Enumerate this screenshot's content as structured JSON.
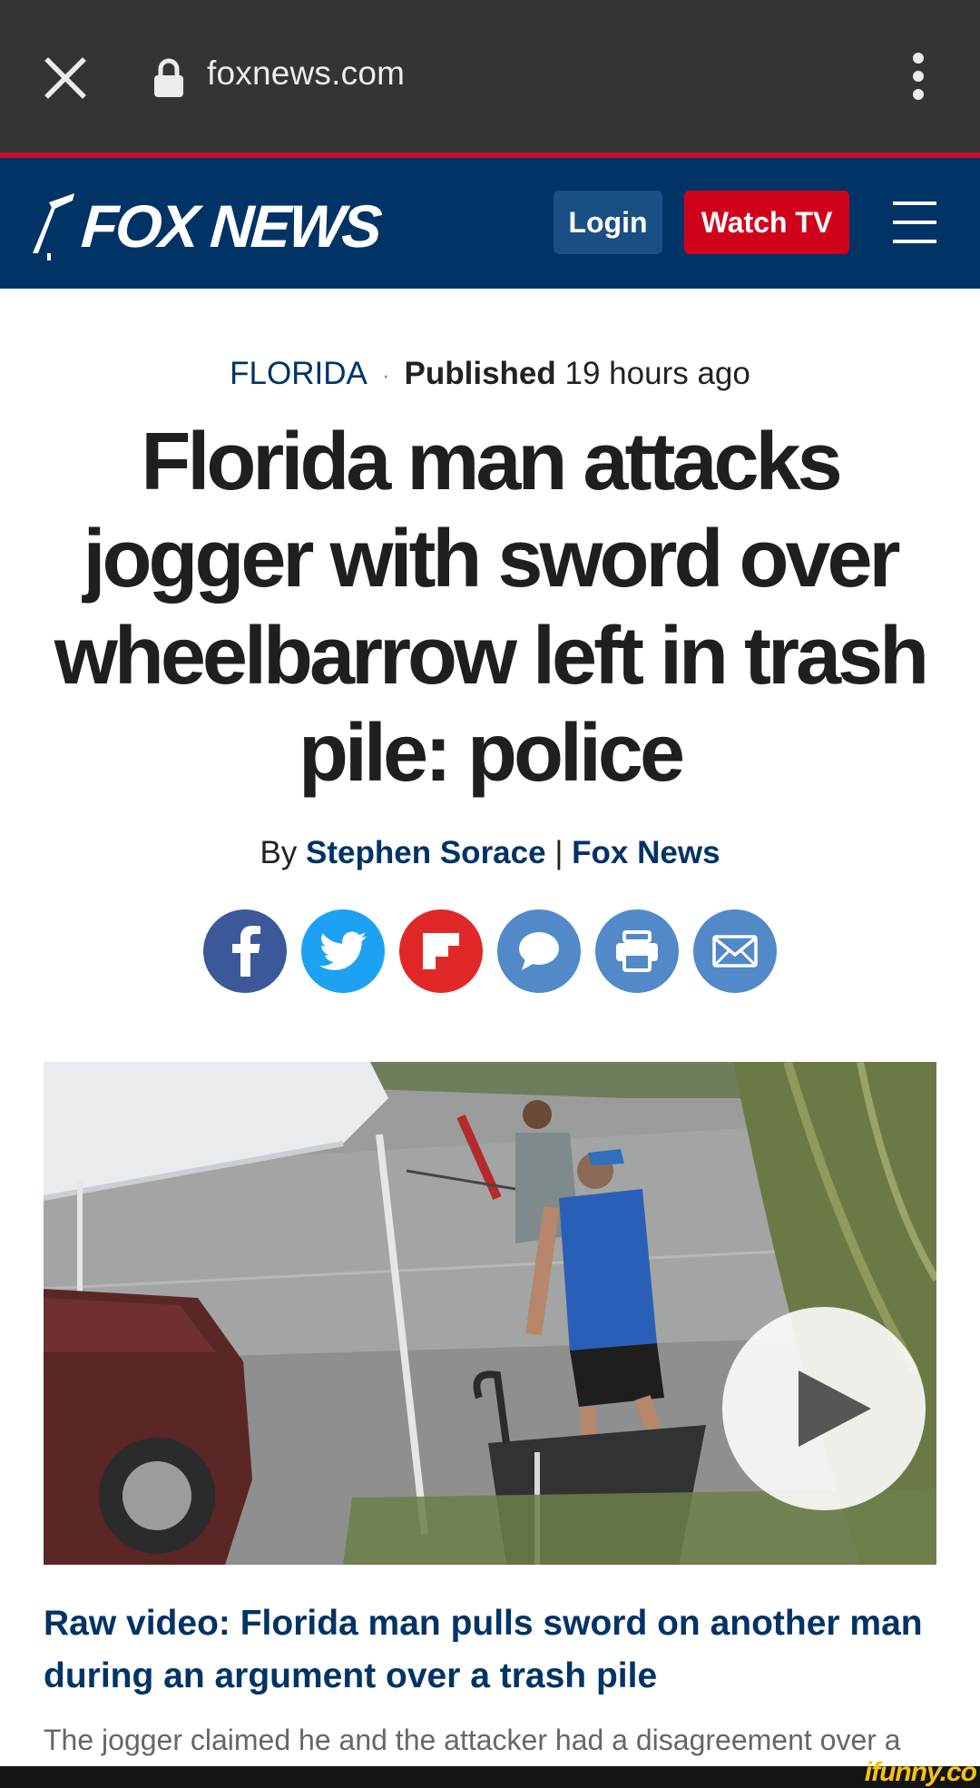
{
  "browser": {
    "url": "foxnews.com",
    "close_icon": "close-icon",
    "lock_icon": "lock-icon",
    "menu_icon": "more-vertical-icon"
  },
  "header": {
    "logo_text": "FOX NEWS",
    "login_label": "Login",
    "watch_label": "Watch TV",
    "menu_icon": "hamburger-icon",
    "colors": {
      "background": "#003366",
      "watch": "#d0021b",
      "login": "#1a4f86"
    }
  },
  "article": {
    "category": "FLORIDA",
    "separator": "·",
    "published_label": "Published",
    "published_time": "19 hours ago",
    "headline": "Florida man attacks jogger with sword over wheelbarrow left in trash pile: police",
    "by_label": "By",
    "author": "Stephen Sorace",
    "byline_sep": "|",
    "outlet": "Fox News"
  },
  "share": [
    {
      "icon": "facebook-icon",
      "color": "#3b5998"
    },
    {
      "icon": "twitter-icon",
      "color": "#1da1f2"
    },
    {
      "icon": "flipboard-icon",
      "color": "#e12828"
    },
    {
      "icon": "comment-icon",
      "color": "#5289c8"
    },
    {
      "icon": "print-icon",
      "color": "#5289c8"
    },
    {
      "icon": "email-icon",
      "color": "#5289c8"
    }
  ],
  "video": {
    "play_icon": "play-icon",
    "title": "Raw video: Florida man pulls sword on another man during an argument over a trash pile",
    "description": "The jogger claimed he and the attacker had a disagreement over a"
  },
  "watermark": "ifunny.co"
}
